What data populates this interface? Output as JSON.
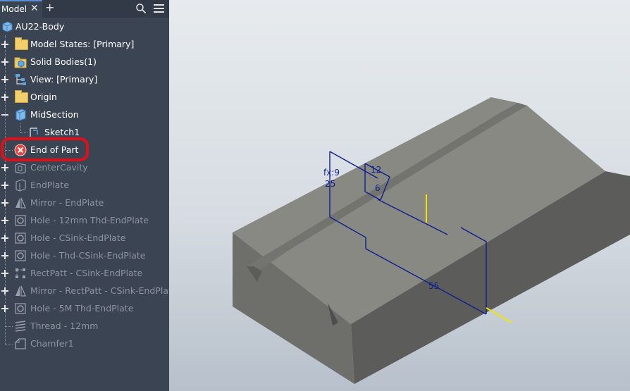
{
  "browser": {
    "tab_label": "Model",
    "tab_close": "✕",
    "tab_add": "+",
    "icons": {
      "search": "search-icon",
      "menu": "hamburger-menu-icon"
    },
    "root_label": "AU22-Body",
    "items": [
      {
        "label": "Model States: [Primary]"
      },
      {
        "label": "Solid Bodies(1)"
      },
      {
        "label": "View: [Primary]"
      },
      {
        "label": "Origin"
      },
      {
        "label": "MidSection"
      },
      {
        "label": "Sketch1"
      },
      {
        "label": "End of Part"
      },
      {
        "label": "CenterCavity"
      },
      {
        "label": "EndPlate"
      },
      {
        "label": "Mirror - EndPlate"
      },
      {
        "label": "Hole - 12mm Thd-EndPlate"
      },
      {
        "label": "Hole - CSink-EndPlate"
      },
      {
        "label": "Hole - Thd-CSink-EndPlate"
      },
      {
        "label": "RectPatt - CSink-EndPlate"
      },
      {
        "label": "Mirror - RectPatt - CSink-EndPlate"
      },
      {
        "label": "Hole - 5M Thd-EndPlate"
      },
      {
        "label": "Thread - 12mm"
      },
      {
        "label": "Chamfer1"
      }
    ]
  },
  "viewport": {
    "dimensions": {
      "d12": "12",
      "d6": "6",
      "dfx": "fx:9",
      "d25": "25",
      "d55": "55"
    }
  },
  "colors": {
    "highlight_ring": "#e0101b",
    "dimension_line": "#0d1f8c",
    "axis_yellow": "#f2e600"
  }
}
